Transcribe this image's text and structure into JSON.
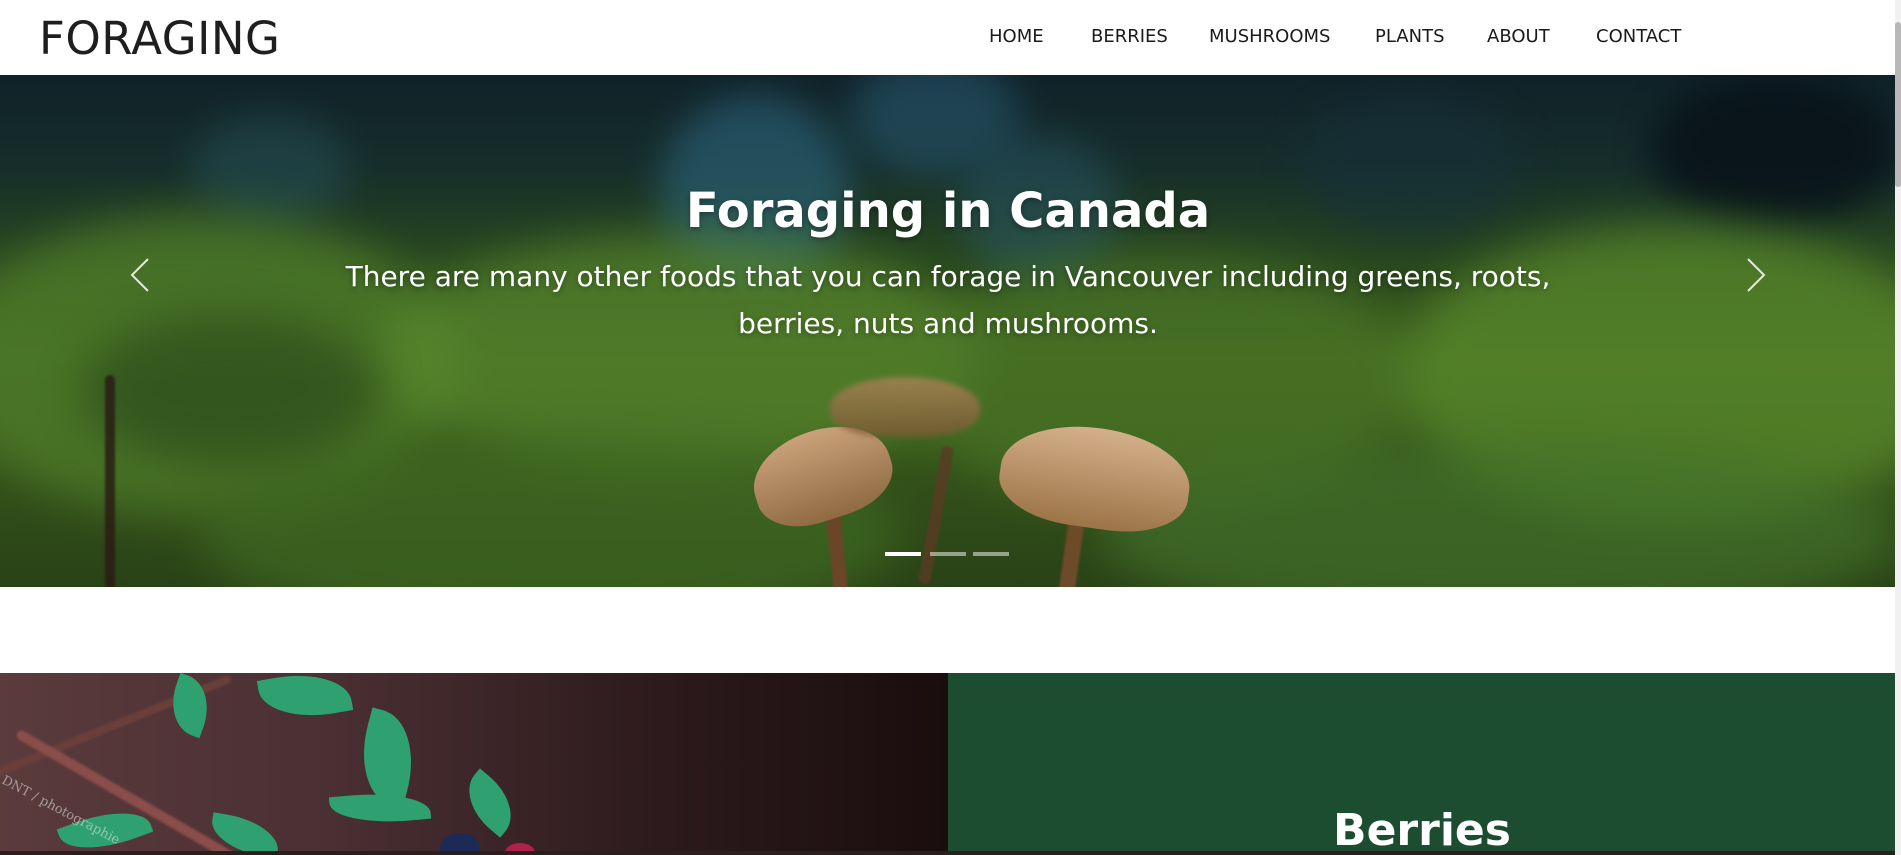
{
  "brand": "FORAGING",
  "nav": {
    "items": [
      "HOME",
      "BERRIES",
      "MUSHROOMS",
      "PLANTS",
      "ABOUT",
      "CONTACT"
    ]
  },
  "carousel": {
    "title": "Foraging in Canada",
    "text": "There are many other foods that you can forage in Vancouver including greens, roots, berries, nuts and mushrooms.",
    "prev_icon": "chevron-left-icon",
    "next_icon": "chevron-right-icon",
    "slide_count": 3,
    "active_slide": 1
  },
  "feature": {
    "heading": "Berries",
    "panel_color": "#1d4d31",
    "watermark": "DNT / photographie"
  }
}
